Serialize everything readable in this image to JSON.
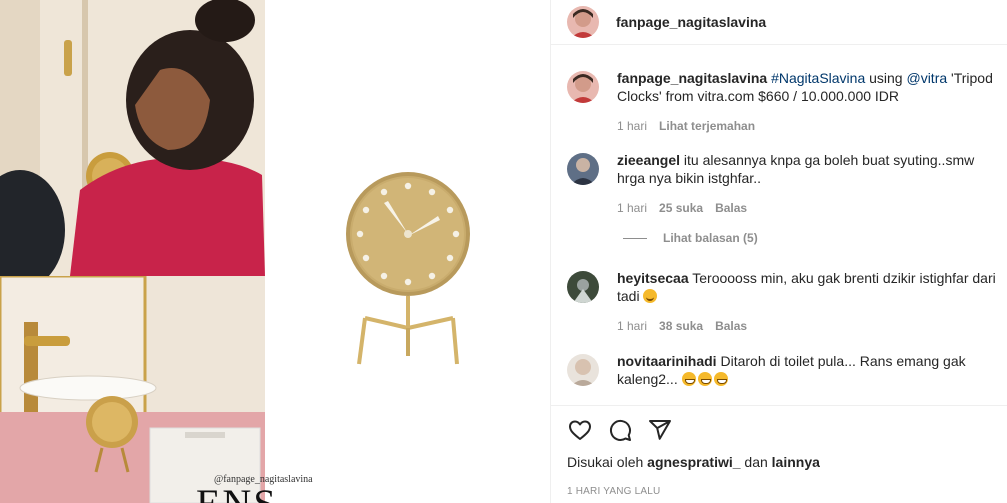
{
  "post": {
    "author": "fanpage_nagitaslavina",
    "watermark": "@fanpage_nagitaslavina",
    "brand_mark": "ENS"
  },
  "caption": {
    "username": "fanpage_nagitaslavina",
    "hashtag": "#NagitaSlavina",
    "text_using": " using ",
    "mention": "@vitra",
    "text_rest": " 'Tripod Clocks' from vitra.com $660 / 10.000.000 IDR",
    "time": "1 hari",
    "translate": "Lihat terjemahan"
  },
  "comments": [
    {
      "username": "zieeangel",
      "text": "itu alesannya knpa ga boleh buat syuting..smw hrga nya bikin istghfar..",
      "time": "1 hari",
      "likes": "25 suka",
      "reply": "Balas"
    },
    {
      "username": "heyitsecaa",
      "text": "Terooooss min, aku gak brenti dzikir istighfar dari tadi",
      "time": "1 hari",
      "likes": "38 suka",
      "reply": "Balas"
    },
    {
      "username": "novitaarinihadi",
      "text": "Ditaroh di toilet pula... Rans emang gak kaleng2...",
      "time": "",
      "likes": "",
      "reply": ""
    }
  ],
  "view_replies": "Lihat balasan (5)",
  "likes_line": {
    "prefix": "Disukai oleh ",
    "user": "agnespratiwi_",
    "middle": " dan ",
    "others": "lainnya"
  },
  "timestamp": "1 HARI YANG LALU",
  "icons": {
    "like": "heart-icon",
    "comment": "comment-icon",
    "share": "send-icon"
  }
}
